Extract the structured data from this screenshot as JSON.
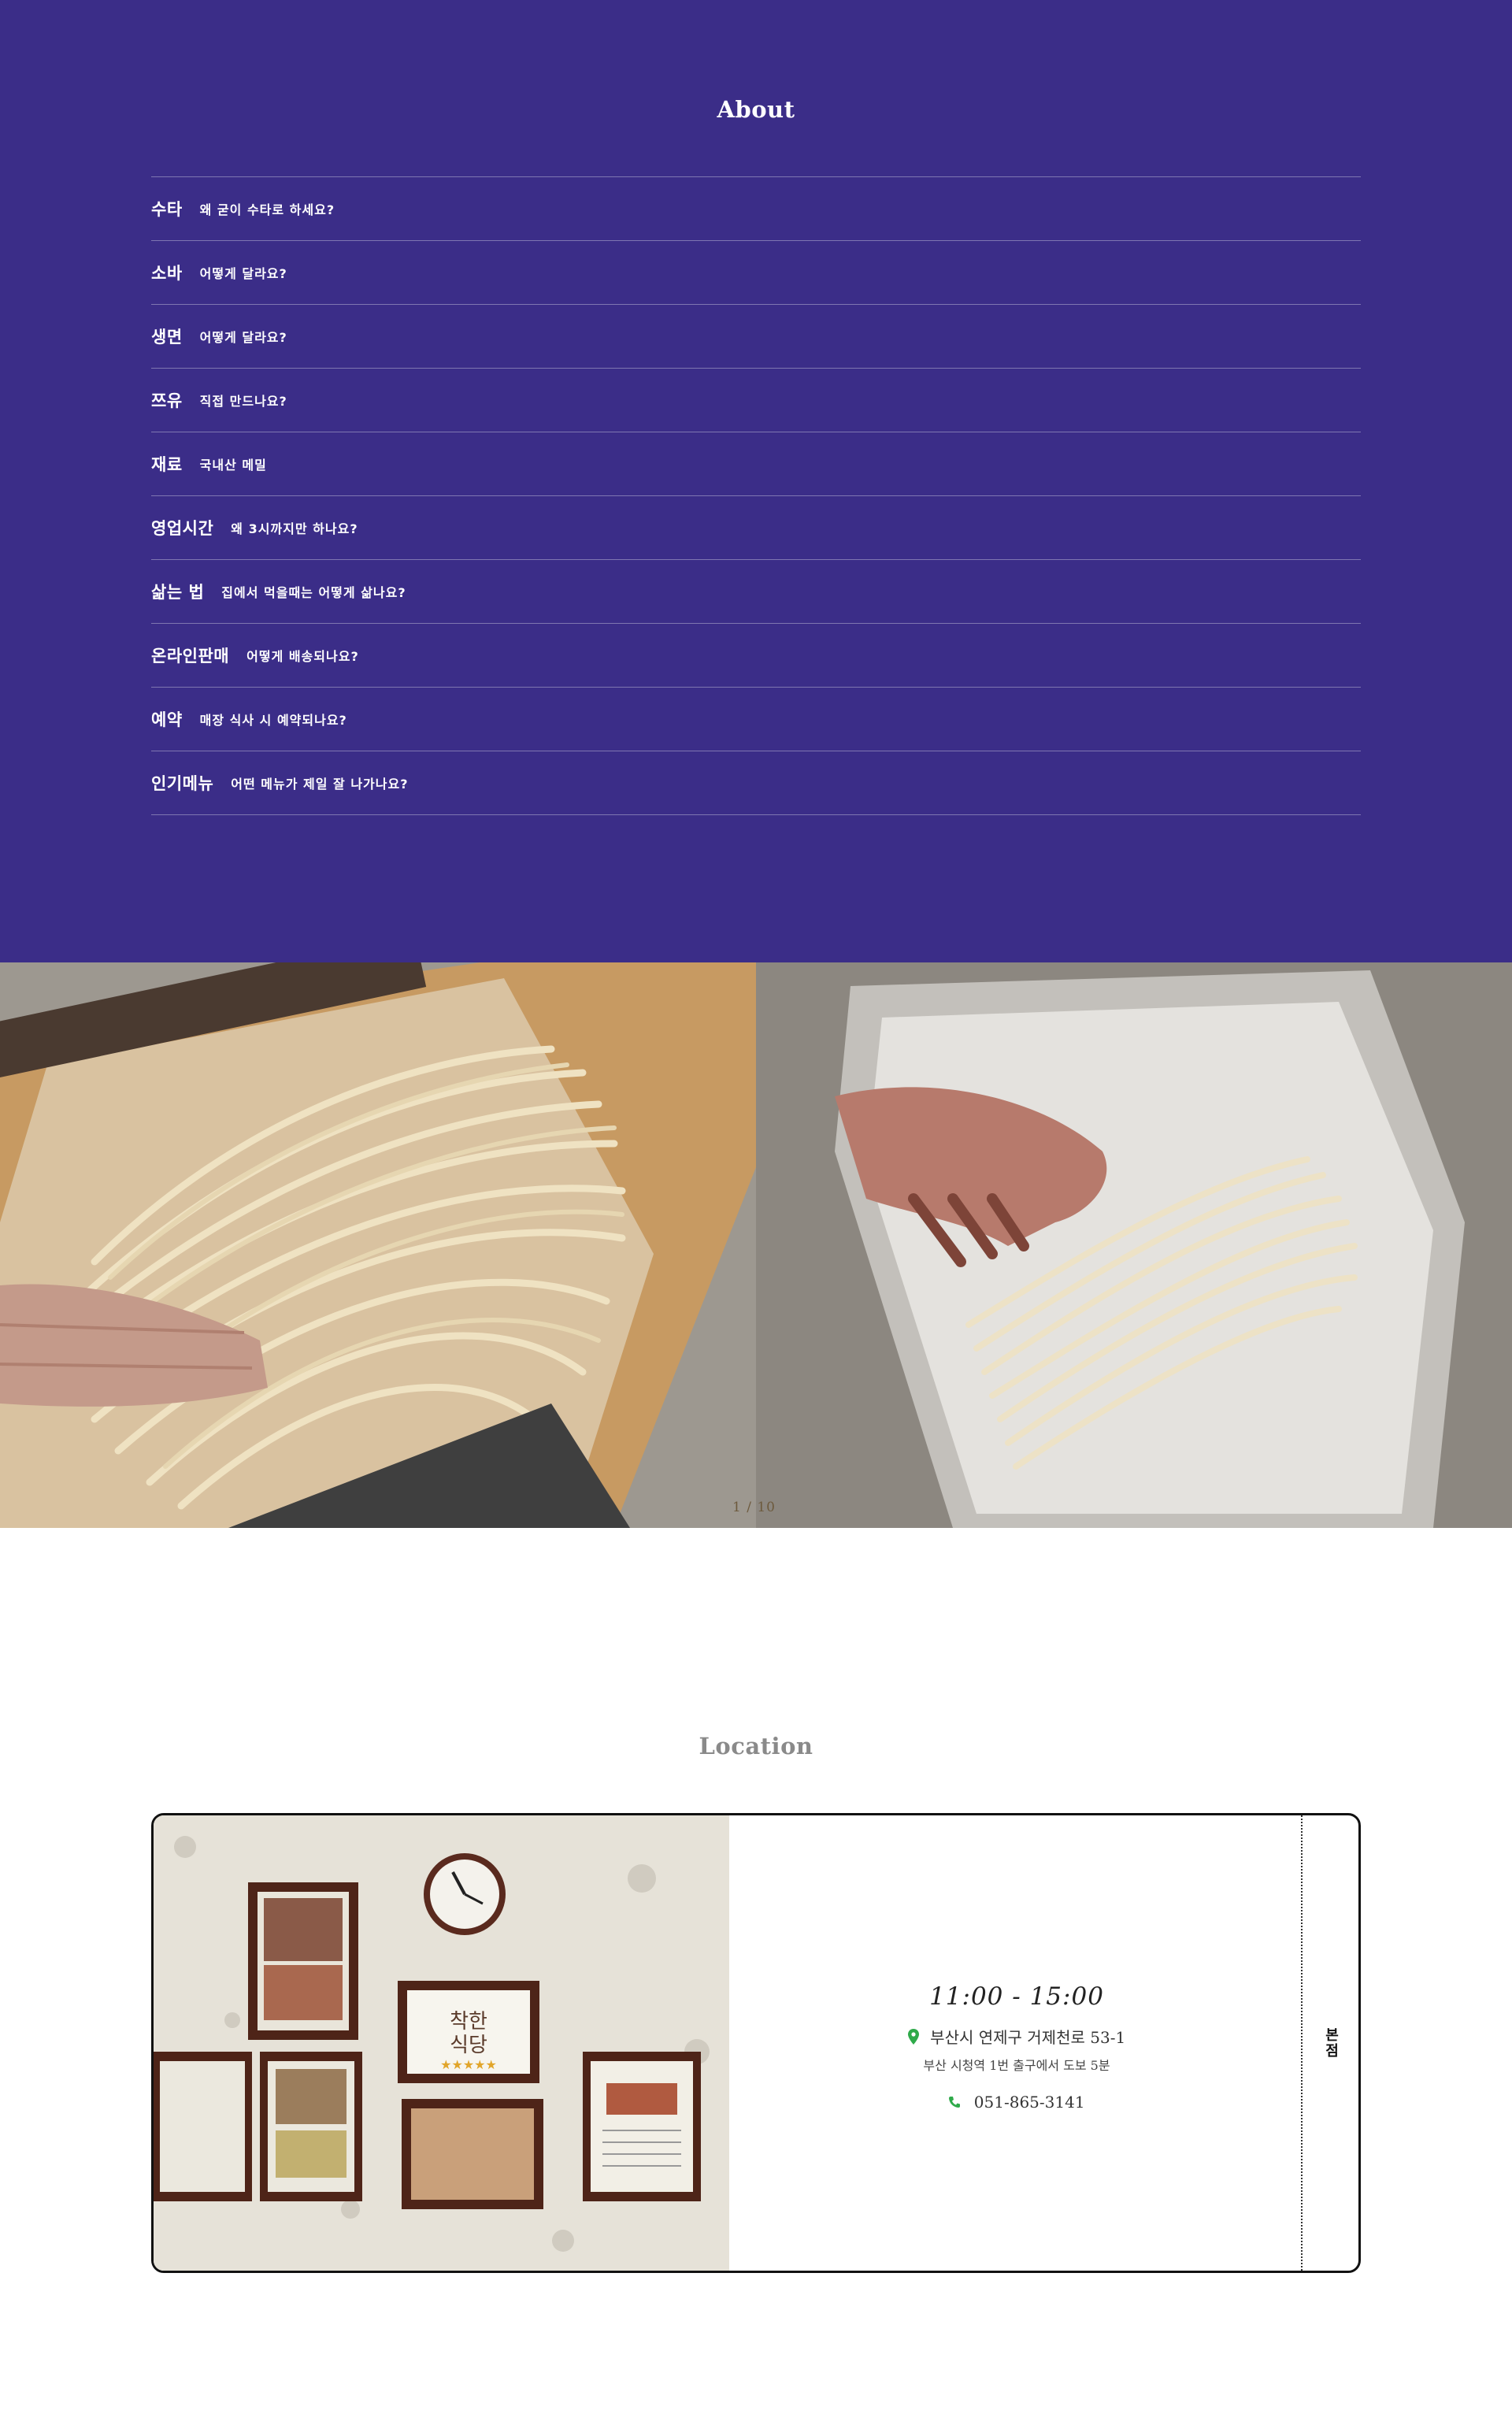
{
  "about": {
    "title": "About",
    "faq": [
      {
        "key": "수타",
        "question": "왜 굳이 수타로 하세요?"
      },
      {
        "key": "소바",
        "question": "어떻게 달라요?"
      },
      {
        "key": "생면",
        "question": "어떻게 달라요?"
      },
      {
        "key": "쯔유",
        "question": "직접 만드나요?"
      },
      {
        "key": "재료",
        "question": "국내산 메밀"
      },
      {
        "key": "영업시간",
        "question": "왜 3시까지만 하나요?"
      },
      {
        "key": "삶는 법",
        "question": "집에서 먹을때는 어떻게 삶나요?"
      },
      {
        "key": "온라인판매",
        "question": "어떻게 배송되나요?"
      },
      {
        "key": "예약",
        "question": "매장 식사 시 예약되나요?"
      },
      {
        "key": "인기메뉴",
        "question": "어떤 메뉴가 제일 잘 나가나요?"
      }
    ]
  },
  "gallery": {
    "pager": "1 / 10"
  },
  "location": {
    "title": "Location",
    "hours": "11:00 - 15:00",
    "address": "부산시 연제구 거제천로 53-1",
    "subway": "부산 시청역 1번 출구에서 도보 5분",
    "phone": "051-865-3141",
    "tab_label": "본점",
    "pin_icon_color": "#2faa4a",
    "phone_icon_color": "#2faa4a"
  },
  "colors": {
    "brand_purple": "#3b2d88"
  }
}
